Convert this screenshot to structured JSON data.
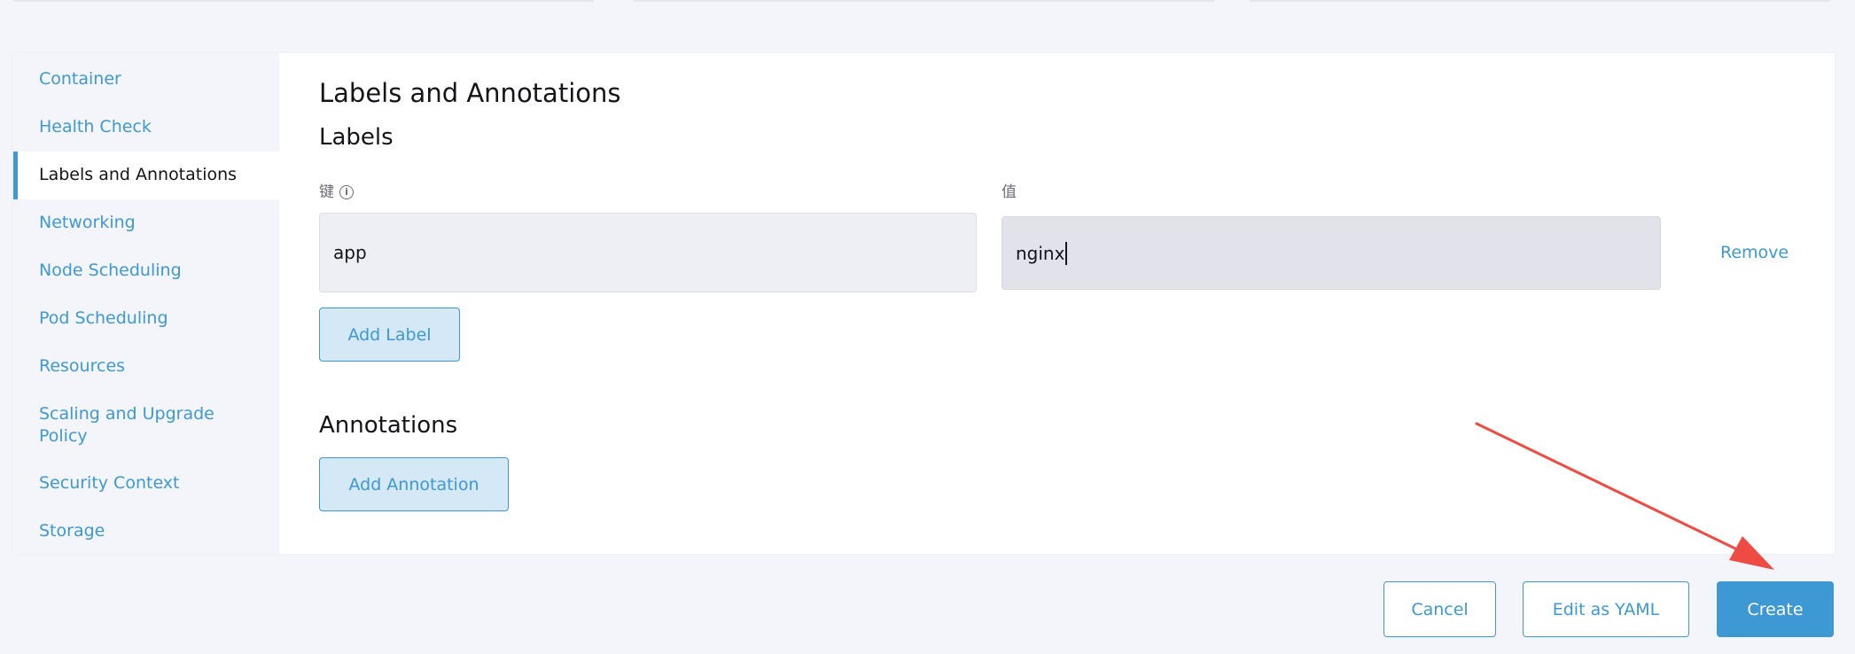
{
  "sidebar": {
    "items": [
      {
        "label": "Container"
      },
      {
        "label": "Health Check"
      },
      {
        "label": "Labels and Annotations",
        "active": true
      },
      {
        "label": "Networking"
      },
      {
        "label": "Node Scheduling"
      },
      {
        "label": "Pod Scheduling"
      },
      {
        "label": "Resources"
      },
      {
        "label": "Scaling and Upgrade Policy"
      },
      {
        "label": "Security Context"
      },
      {
        "label": "Storage"
      }
    ]
  },
  "main": {
    "section_title": "Labels and Annotations",
    "labels": {
      "title": "Labels",
      "key_label": "键",
      "value_label": "值",
      "row": {
        "key": "app",
        "value": "nginx"
      },
      "remove_label": "Remove",
      "add_button": "Add Label"
    },
    "annotations": {
      "title": "Annotations",
      "add_button": "Add Annotation"
    }
  },
  "footer": {
    "cancel": "Cancel",
    "edit_yaml": "Edit as YAML",
    "create": "Create"
  },
  "colors": {
    "accent": "#3d98d3",
    "annotation_arrow": "#ef4b45"
  },
  "icons": {
    "info": "info-icon"
  }
}
